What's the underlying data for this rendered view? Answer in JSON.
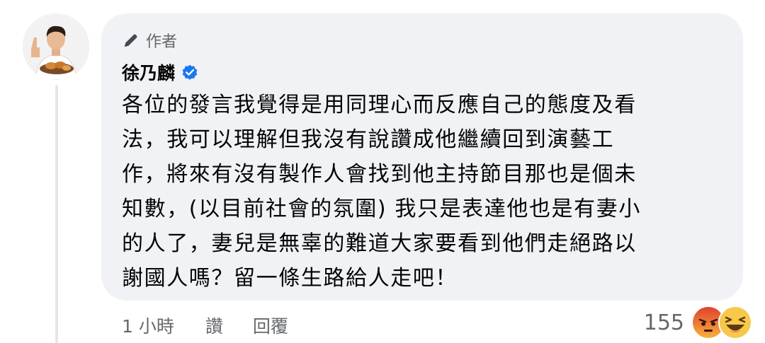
{
  "comment": {
    "author_badge": "作者",
    "author_name": "徐乃麟",
    "text_lines": [
      "各位的發言我覺得是用同理心而反應自己的態度及看",
      "法，我可以理解但我沒有說讚成他繼續回到演藝工",
      "作，將來有沒有製作人會找到他主持節目那也是個未",
      "知數，(以目前社會的氛圍) 我只是表達他也是有妻小",
      "的人了，妻兒是無辜的難道大家要看到他們走絕路以",
      "謝國人嗎？留一條生路給人走吧！"
    ]
  },
  "footer": {
    "time": "1 小時",
    "like_label": "讚",
    "reply_label": "回覆"
  },
  "reactions": {
    "count": "155",
    "icons": [
      "angry-reaction-icon",
      "haha-reaction-icon"
    ]
  },
  "colors": {
    "bubble_bg": "#f0f2f5",
    "secondary_text": "#65676b",
    "verified_blue": "#1877f2",
    "angry_red": "#e9710f",
    "haha_yellow": "#f7b125"
  }
}
